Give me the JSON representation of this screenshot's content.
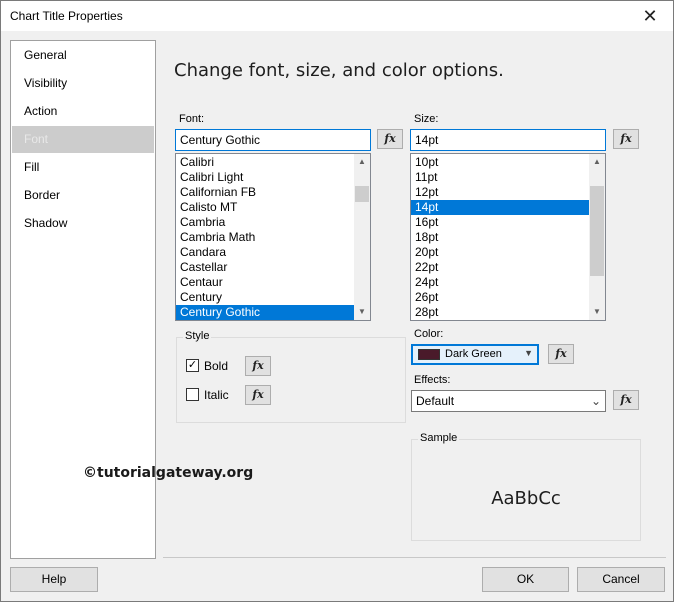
{
  "window": {
    "title": "Chart Title Properties"
  },
  "sidebar": {
    "items": [
      {
        "label": "General"
      },
      {
        "label": "Visibility"
      },
      {
        "label": "Action"
      },
      {
        "label": "Font",
        "selected": true
      },
      {
        "label": "Fill"
      },
      {
        "label": "Border"
      },
      {
        "label": "Shadow"
      }
    ]
  },
  "main": {
    "heading": "Change font, size, and color options.",
    "font": {
      "label": "Font:",
      "value": "Century Gothic",
      "options": [
        "Calibri",
        "Calibri Light",
        "Californian FB",
        "Calisto MT",
        "Cambria",
        "Cambria Math",
        "Candara",
        "Castellar",
        "Centaur",
        "Century",
        "Century Gothic"
      ],
      "selected": "Century Gothic"
    },
    "size": {
      "label": "Size:",
      "value": "14pt",
      "options": [
        "10pt",
        "11pt",
        "12pt",
        "14pt",
        "16pt",
        "18pt",
        "20pt",
        "22pt",
        "24pt",
        "26pt",
        "28pt"
      ],
      "selected": "14pt"
    },
    "style": {
      "group_label": "Style",
      "bold_label": "Bold",
      "bold_checked": true,
      "italic_label": "Italic",
      "italic_checked": false
    },
    "color": {
      "label": "Color:",
      "value": "Dark Green",
      "swatch": "#4a1a2a"
    },
    "effects": {
      "label": "Effects:",
      "value": "Default"
    },
    "sample": {
      "group_label": "Sample",
      "text": "AaBbCc"
    },
    "fx_label": "fx",
    "watermark": "©tutorialgateway.org"
  },
  "footer": {
    "help_label": "Help",
    "ok_label": "OK",
    "cancel_label": "Cancel"
  },
  "icons": {
    "close": "close-icon",
    "expression": "fx-icon",
    "dropdown": "chevron-down-icon",
    "scroll_up": "scroll-up-icon",
    "scroll_down": "scroll-down-icon"
  }
}
